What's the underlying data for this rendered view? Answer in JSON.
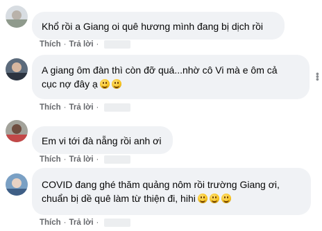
{
  "comments": [
    {
      "text": "Khổ rồi a Giang oi quê hương mình đang bị dịch rồi",
      "emoji_count": 0,
      "like_label": "Thích",
      "reply_label": "Trả lời"
    },
    {
      "text": "A giang ôm đàn thì còn đỡ quá...nhờ cô Vi mà e ôm cả\ncục nợ đây ạ",
      "emoji_count": 2,
      "like_label": "Thích",
      "reply_label": "Trả lời"
    },
    {
      "text": "Em vi tới đà nẵng rồi anh ơi",
      "emoji_count": 0,
      "like_label": "Thích",
      "reply_label": "Trả lời"
    },
    {
      "text": "COVID đang ghé thăm quảng nôm rồi trường Giang ơi,\nchuẩn bị dề quê làm từ thiện đi, hihi",
      "emoji_count": 3,
      "like_label": "Thích",
      "reply_label": "Trả lời"
    }
  ],
  "separator": "·",
  "icons": {
    "avatar": "avatar-icon",
    "emoji": "grinning-face-emoji-icon",
    "more": "more-options-icon"
  },
  "colors": {
    "bubble_bg": "#f0f2f5",
    "text": "#050505",
    "action_text": "#65676b"
  }
}
